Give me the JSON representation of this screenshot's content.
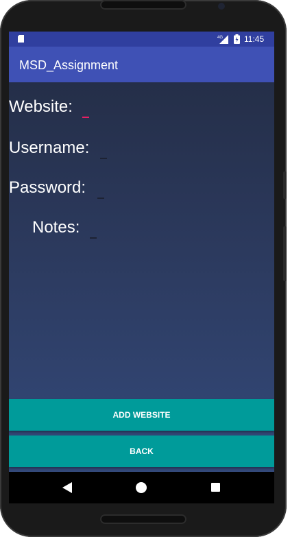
{
  "status_bar": {
    "network": "4G",
    "time": "11:45"
  },
  "app_bar": {
    "title": "MSD_Assignment"
  },
  "form": {
    "website_label": "Website:",
    "username_label": "Username:",
    "password_label": "Password:",
    "notes_label": "Notes:",
    "website_value": "",
    "username_value": "",
    "password_value": "",
    "notes_value": ""
  },
  "buttons": {
    "add_website": "ADD WEBSITE",
    "back": "BACK"
  },
  "colors": {
    "status_bar": "#303f9f",
    "app_bar": "#3f51b5",
    "button": "#009b9a",
    "focus_accent": "#e91e63"
  },
  "icons": {
    "status": [
      "sd-card-icon",
      "signal-icon",
      "battery-icon"
    ],
    "nav": [
      "back-icon",
      "home-icon",
      "recent-apps-icon"
    ]
  }
}
